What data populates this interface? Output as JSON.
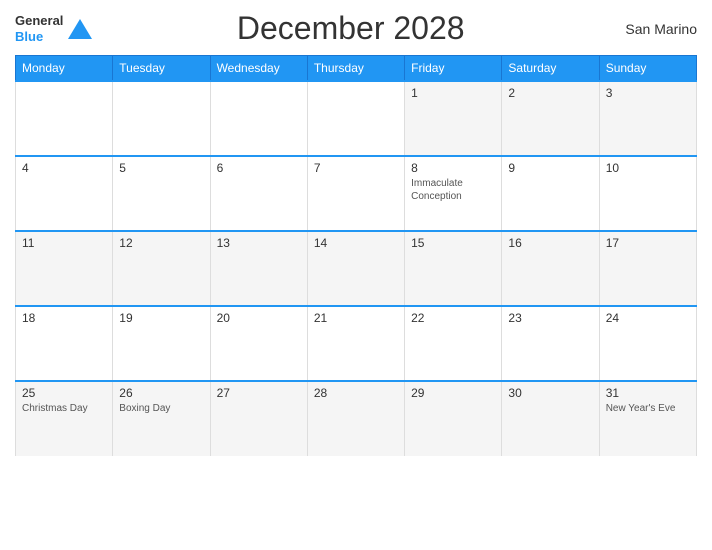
{
  "header": {
    "logo": {
      "line1": "General",
      "line2": "Blue"
    },
    "title": "December 2028",
    "country": "San Marino"
  },
  "weekdays": [
    "Monday",
    "Tuesday",
    "Wednesday",
    "Thursday",
    "Friday",
    "Saturday",
    "Sunday"
  ],
  "weeks": [
    [
      {
        "day": "",
        "holiday": ""
      },
      {
        "day": "",
        "holiday": ""
      },
      {
        "day": "",
        "holiday": ""
      },
      {
        "day": "",
        "holiday": ""
      },
      {
        "day": "1",
        "holiday": ""
      },
      {
        "day": "2",
        "holiday": ""
      },
      {
        "day": "3",
        "holiday": ""
      }
    ],
    [
      {
        "day": "4",
        "holiday": ""
      },
      {
        "day": "5",
        "holiday": ""
      },
      {
        "day": "6",
        "holiday": ""
      },
      {
        "day": "7",
        "holiday": ""
      },
      {
        "day": "8",
        "holiday": "Immaculate Conception"
      },
      {
        "day": "9",
        "holiday": ""
      },
      {
        "day": "10",
        "holiday": ""
      }
    ],
    [
      {
        "day": "11",
        "holiday": ""
      },
      {
        "day": "12",
        "holiday": ""
      },
      {
        "day": "13",
        "holiday": ""
      },
      {
        "day": "14",
        "holiday": ""
      },
      {
        "day": "15",
        "holiday": ""
      },
      {
        "day": "16",
        "holiday": ""
      },
      {
        "day": "17",
        "holiday": ""
      }
    ],
    [
      {
        "day": "18",
        "holiday": ""
      },
      {
        "day": "19",
        "holiday": ""
      },
      {
        "day": "20",
        "holiday": ""
      },
      {
        "day": "21",
        "holiday": ""
      },
      {
        "day": "22",
        "holiday": ""
      },
      {
        "day": "23",
        "holiday": ""
      },
      {
        "day": "24",
        "holiday": ""
      }
    ],
    [
      {
        "day": "25",
        "holiday": "Christmas Day"
      },
      {
        "day": "26",
        "holiday": "Boxing Day"
      },
      {
        "day": "27",
        "holiday": ""
      },
      {
        "day": "28",
        "holiday": ""
      },
      {
        "day": "29",
        "holiday": ""
      },
      {
        "day": "30",
        "holiday": ""
      },
      {
        "day": "31",
        "holiday": "New Year's Eve"
      }
    ]
  ]
}
